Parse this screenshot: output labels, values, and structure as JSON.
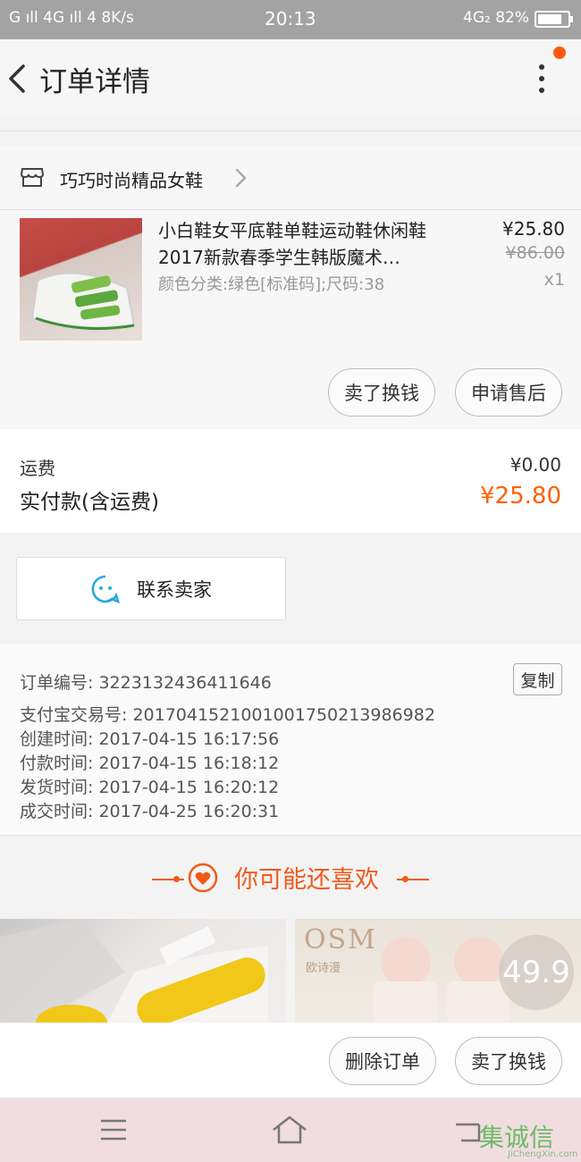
{
  "status_bar": {
    "left": "G ıll 4G ıll 4 8K/s",
    "time": "20:13",
    "right": "4G₂ 82%",
    "battery_level": 0.82
  },
  "header": {
    "title": "订单详情"
  },
  "store": {
    "name": "巧巧时尚精品女鞋"
  },
  "product": {
    "name": "小白鞋女平底鞋单鞋运动鞋休闲鞋2017新款春季学生韩版魔术…",
    "sku": "颜色分类:绿色[标准码];尺码:38",
    "price": "¥25.80",
    "original_price": "¥86.00",
    "quantity": "x1"
  },
  "product_actions": {
    "sell": "卖了换钱",
    "after_sale": "申请售后"
  },
  "fees": {
    "shipping_label": "运费",
    "shipping_value": "¥0.00",
    "paid_label": "实付款(含运费)",
    "paid_value": "¥25.80"
  },
  "contact": {
    "label": "联系卖家"
  },
  "order_info": {
    "order_no": "订单编号: 3223132436411646",
    "alipay_no": "支付宝交易号: 2017041521001001750213986982",
    "created": "创建时间: 2017-04-15  16:17:56",
    "paid": "付款时间: 2017-04-15  16:18:12",
    "shipped": "发货时间: 2017-04-15  16:20:12",
    "closed": "成交时间: 2017-04-25  16:20:31",
    "copy": "复制"
  },
  "recommend": {
    "title": "你可能还喜欢",
    "item2_brand": "OSM",
    "item2_sub": "欧诗漫",
    "item2_price": "49.9"
  },
  "bottom_actions": {
    "delete": "删除订单",
    "sell": "卖了换钱"
  },
  "watermark": {
    "text": "集诚信",
    "url": "JiChengXin.com"
  },
  "colors": {
    "accent": "#ff6000",
    "status_bar": "#a3a3a3",
    "nav_bar": "#f1dde0"
  }
}
